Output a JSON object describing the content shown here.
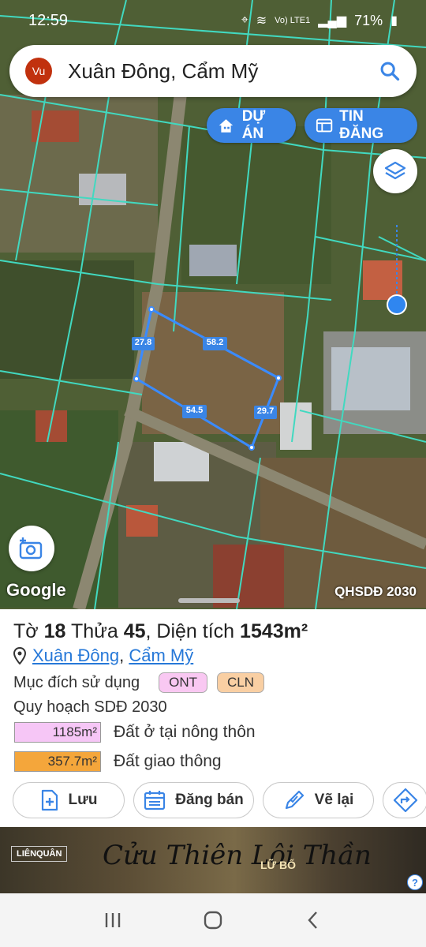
{
  "status_bar": {
    "time": "12:59",
    "signal": "Vo) LTE1",
    "battery": "71%"
  },
  "search": {
    "avatar": "Vu",
    "query": "Xuân Đông, Cẩm Mỹ"
  },
  "map": {
    "btn_du_an": "DỰ ÁN",
    "btn_tin_dang": "TIN ĐĂNG",
    "google_logo": "Google",
    "badge": "QHSDĐ 2030",
    "plot_dimensions": [
      "27.8",
      "58.2",
      "54.5",
      "29.7"
    ]
  },
  "parcel": {
    "title_prefix": "Tờ",
    "sheet": "18",
    "plot_label": "Thửa",
    "plot": "45",
    "area_label": ", Diện tích",
    "area": "1543m²",
    "address_commune": "Xuân Đông",
    "address_sep": ",",
    "address_district": "Cẩm Mỹ",
    "purpose_label": "Mục đích sử dụng",
    "purpose_tags": [
      "ONT",
      "CLN"
    ],
    "plan_label": "Quy hoạch SDĐ 2030",
    "land_uses": [
      {
        "area": "1185m²",
        "desc": "Đất ở tại nông thôn",
        "color": "#f6c6f6"
      },
      {
        "area": "357.7m²",
        "desc": "Đất giao thông",
        "color": "#f4a63b"
      }
    ]
  },
  "actions": {
    "save": "Lưu",
    "sell": "Đăng bán",
    "redraw": "Vẽ lại"
  },
  "ad": {
    "brand": "LIÊNQUÂN",
    "title": "Cửu Thiên Lôi Thần",
    "sub": "LỮ BỐ",
    "info_icon": "?"
  },
  "colors": {
    "accent": "#3a85e6",
    "link": "#2678d8",
    "boundary": "#41d9c0",
    "plot_line": "#3a8bff"
  }
}
